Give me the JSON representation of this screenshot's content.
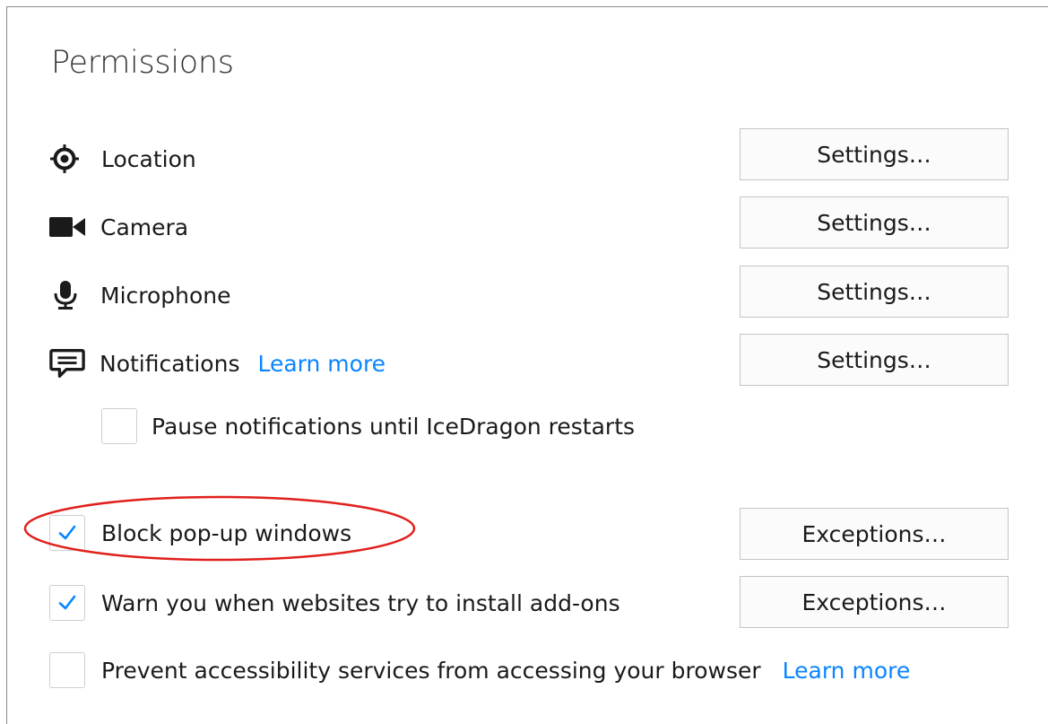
{
  "section": {
    "title": "Permissions"
  },
  "permissions": [
    {
      "icon": "location-icon",
      "label": "Location",
      "button": "Settings…"
    },
    {
      "icon": "camera-icon",
      "label": "Camera",
      "button": "Settings…"
    },
    {
      "icon": "microphone-icon",
      "label": "Microphone",
      "button": "Settings…"
    },
    {
      "icon": "notifications-icon",
      "label": "Notifications",
      "link": "Learn more",
      "button": "Settings…"
    }
  ],
  "pause_notifications": {
    "label": "Pause notifications until IceDragon restarts",
    "checked": false
  },
  "block_popups": {
    "label": "Block pop-up windows",
    "checked": true,
    "button": "Exceptions…"
  },
  "warn_addons": {
    "label": "Warn you when websites try to install add-ons",
    "checked": true,
    "button": "Exceptions…"
  },
  "prevent_accessibility": {
    "label": "Prevent accessibility services from accessing your browser",
    "checked": false,
    "link": "Learn more"
  },
  "colors": {
    "link": "#0a84ff",
    "checkmark": "#0a84ff",
    "highlight_ellipse": "#e0201c"
  }
}
